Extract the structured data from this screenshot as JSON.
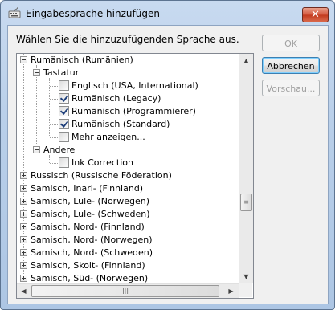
{
  "window": {
    "title": "Eingabesprache hinzufügen",
    "close_glyph": "✕"
  },
  "instruction": "Wählen Sie die hinzuzufügenden Sprache aus.",
  "buttons": {
    "ok": "OK",
    "cancel": "Abbrechen",
    "preview": "Vorschau..."
  },
  "tree": {
    "root": "Rumänisch (Rumänien)",
    "keyboard_group": "Tastatur",
    "keyboards": [
      {
        "label": "Englisch (USA, International)",
        "checked": false
      },
      {
        "label": "Rumänisch (Legacy)",
        "checked": true
      },
      {
        "label": "Rumänisch (Programmierer)",
        "checked": true
      },
      {
        "label": "Rumänisch (Standard)",
        "checked": true
      },
      {
        "label": "Mehr anzeigen...",
        "checked": false
      }
    ],
    "other_group": "Andere",
    "other_items": [
      {
        "label": "Ink Correction",
        "checked": false
      }
    ],
    "languages": [
      "Russisch (Russische Föderation)",
      "Samisch, Inari- (Finnland)",
      "Samisch, Lule- (Norwegen)",
      "Samisch, Lule- (Schweden)",
      "Samisch, Nord- (Finnland)",
      "Samisch, Nord- (Norwegen)",
      "Samisch, Nord- (Schweden)",
      "Samisch, Skolt- (Finnland)",
      "Samisch, Süd- (Norwegen)"
    ]
  },
  "scrollbars": {
    "vertical_position": 0.62,
    "horizontal_position": 0.45
  }
}
